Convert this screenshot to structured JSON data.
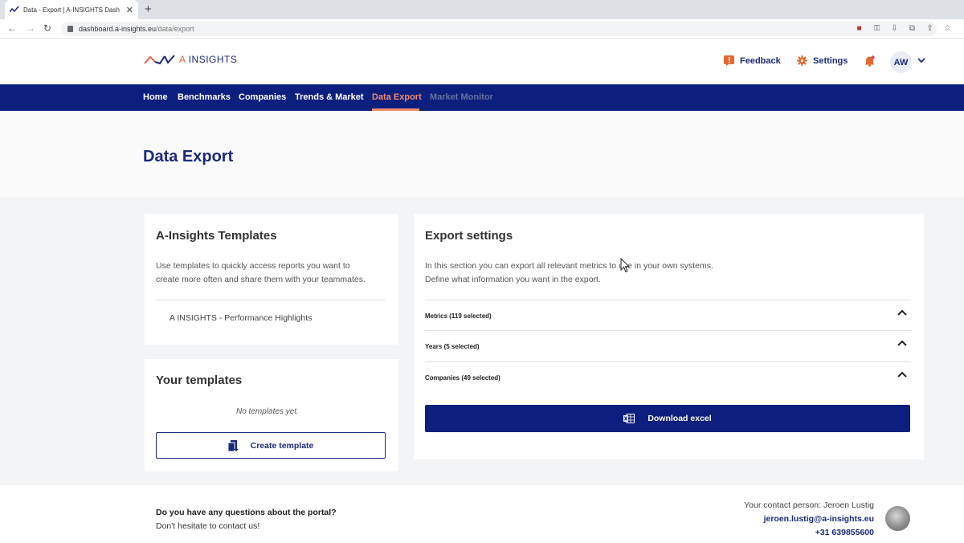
{
  "browser": {
    "tab_title": "Data - Export | A-INSIGHTS Dash",
    "url_host": "dashboard.a-insights.eu",
    "url_path": "/data/export"
  },
  "header": {
    "logo_prefix": "A",
    "logo_suffix": "INSIGHTS",
    "feedback_label": "Feedback",
    "settings_label": "Settings",
    "avatar_initials": "AW"
  },
  "nav": {
    "items": [
      "Home",
      "Benchmarks",
      "Companies",
      "Trends & Market",
      "Data Export",
      "Market Monitor"
    ],
    "active": "Data Export"
  },
  "page": {
    "title": "Data Export"
  },
  "ai_templates": {
    "title": "A-Insights Templates",
    "description_line1": "Use templates to quickly access reports you want to",
    "description_line2": "create more often and share them with your teammates.",
    "items": [
      "A INSIGHTS - Performance Highlights"
    ]
  },
  "your_templates": {
    "title": "Your templates",
    "empty_text": "No templates yet.",
    "create_label": "Create template"
  },
  "export_settings": {
    "title": "Export settings",
    "description_line1": "In this section you can export all relevant metrics to use in your own systems.",
    "description_line2": "Define what information you want in the export.",
    "sections": [
      {
        "label": "Metrics (119 selected)"
      },
      {
        "label": "Years (5 selected)"
      },
      {
        "label": "Companies (49 selected)"
      }
    ],
    "download_label": "Download excel"
  },
  "footer": {
    "question": "Do you have any questions about the portal?",
    "subtext": "Don't hesitate to contact us!",
    "contact_person": "Your contact person: Jeroen Lustig",
    "email": "jeroen.lustig@a-insights.eu",
    "phone": "+31 639855600"
  },
  "colors": {
    "brand_navy": "#0d1f7e",
    "accent_coral": "#f08a6f",
    "alert_orange": "#e8672f"
  }
}
